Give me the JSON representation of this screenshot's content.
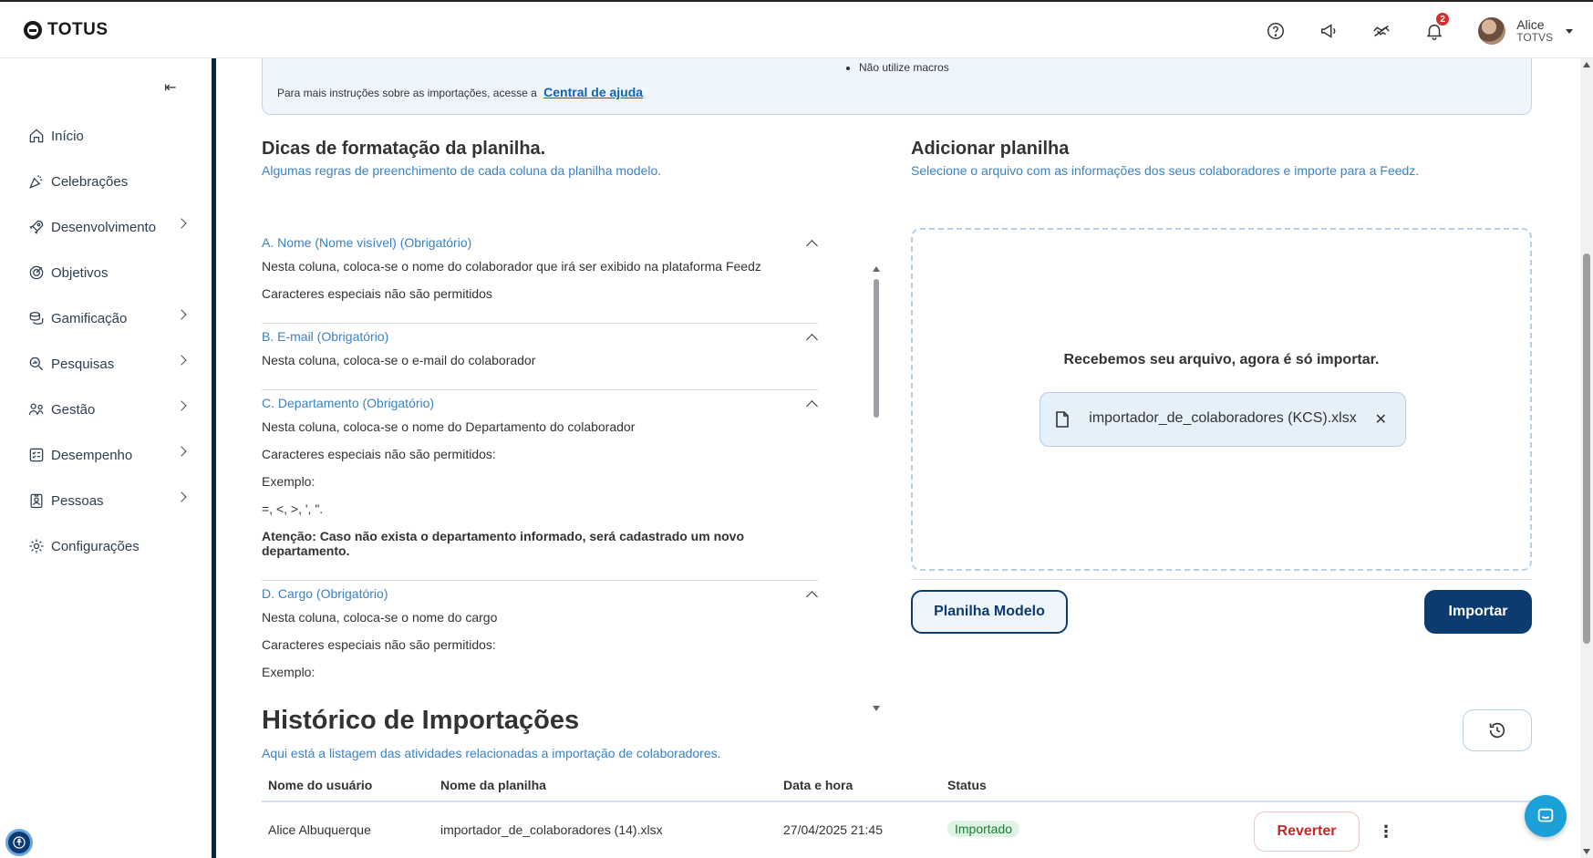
{
  "header": {
    "logo_text": "TOTUS",
    "notifications_count": "2",
    "user_name": "Alice",
    "user_org": "TOTVS"
  },
  "sidebar": {
    "collapse_glyph": "⇤",
    "items": [
      {
        "label": "Início",
        "icon": "home-icon",
        "has_children": false
      },
      {
        "label": "Celebrações",
        "icon": "party-icon",
        "has_children": false
      },
      {
        "label": "Desenvolvimento",
        "icon": "rocket-icon",
        "has_children": true
      },
      {
        "label": "Objetivos",
        "icon": "target-icon",
        "has_children": false
      },
      {
        "label": "Gamificação",
        "icon": "coins-icon",
        "has_children": true
      },
      {
        "label": "Pesquisas",
        "icon": "search-chart-icon",
        "has_children": true
      },
      {
        "label": "Gestão",
        "icon": "people-icon",
        "has_children": true
      },
      {
        "label": "Desempenho",
        "icon": "checklist-icon",
        "has_children": true
      },
      {
        "label": "Pessoas",
        "icon": "badge-icon",
        "has_children": true
      },
      {
        "label": "Configurações",
        "icon": "gear-icon",
        "has_children": false
      }
    ]
  },
  "info_box": {
    "bullet": "Não utilize macros",
    "text": "Para mais instruções sobre as importações, acesse a",
    "link": "Central de ajuda"
  },
  "tips": {
    "title": "Dicas de formatação da planilha.",
    "subtitle": "Algumas regras de preenchimento de cada coluna da planilha modelo.",
    "items": [
      {
        "title": "A. Nome (Nome visível) (Obrigatório)",
        "lines": [
          "Nesta coluna, coloca-se o nome do colaborador que irá ser exibido na plataforma Feedz",
          "Caracteres especiais não são permitidos"
        ],
        "bold": ""
      },
      {
        "title": "B. E-mail (Obrigatório)",
        "lines": [
          "Nesta coluna, coloca-se o e-mail do colaborador"
        ],
        "bold": ""
      },
      {
        "title": "C. Departamento (Obrigatório)",
        "lines": [
          "Nesta coluna, coloca-se o nome do Departamento do colaborador",
          "Caracteres especiais não são permitidos:",
          "Exemplo:",
          "=, <, >, ', \"."
        ],
        "bold": "Atenção: Caso não exista o departamento informado, será cadastrado um novo departamento."
      },
      {
        "title": "D. Cargo (Obrigatório)",
        "lines": [
          "Nesta coluna, coloca-se o nome do cargo",
          "Caracteres especiais não são permitidos:",
          "Exemplo:"
        ],
        "bold": ""
      }
    ]
  },
  "upload": {
    "title": "Adicionar planilha",
    "subtitle": "Selecione o arquivo com as informações dos seus colaboradores e importe para a Feedz.",
    "message": "Recebemos seu arquivo, agora é só importar.",
    "file_name": "importador_de_colaboradores (KCS).xlsx",
    "template_button": "Planilha Modelo",
    "import_button": "Importar"
  },
  "history": {
    "title": "Histórico de Importações",
    "subtitle": "Aqui está a listagem das atividades relacionadas a importação de colaboradores.",
    "columns": [
      "Nome do usuário",
      "Nome da planilha",
      "Data e hora",
      "Status"
    ],
    "rows": [
      {
        "user": "Alice Albuquerque",
        "sheet": "importador_de_colaboradores (14).xlsx",
        "datetime": "27/04/2025 21:45",
        "status": "Importado",
        "action": "Reverter"
      }
    ]
  },
  "colors": {
    "primary": "#0b3b6f",
    "link": "#3b82c4",
    "success_bg": "#dff3e4",
    "danger": "#c62828"
  }
}
